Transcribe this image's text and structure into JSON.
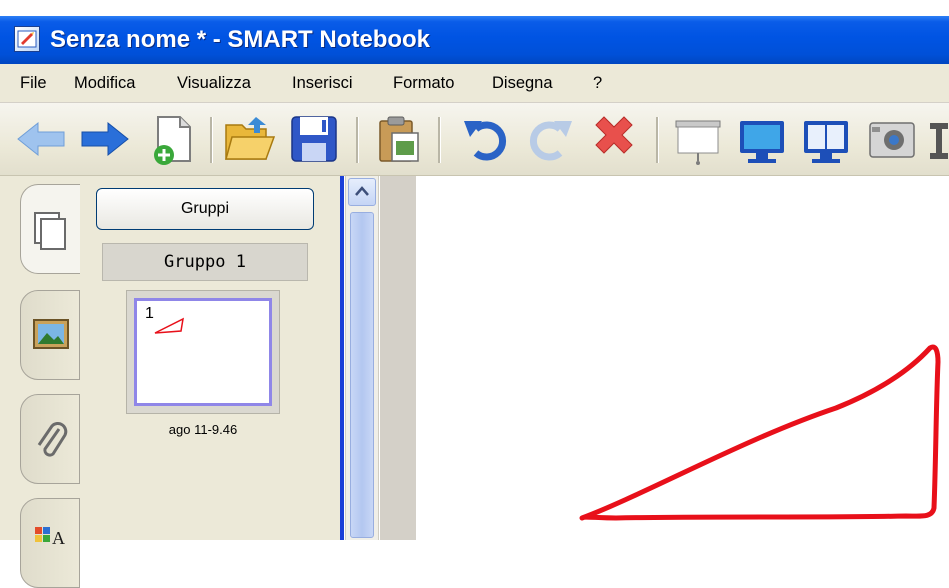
{
  "window": {
    "title": "Senza nome * - SMART Notebook",
    "app_icon": "smart-notebook-icon"
  },
  "menu": {
    "items": [
      "File",
      "Modifica",
      "Visualizza",
      "Inserisci",
      "Formato",
      "Disegna",
      "?"
    ]
  },
  "toolbar": {
    "icons": [
      "back-arrow-icon",
      "forward-arrow-icon",
      "new-page-icon",
      "open-folder-icon",
      "save-icon",
      "paste-icon",
      "undo-icon",
      "redo-icon",
      "delete-icon",
      "projector-screen-icon",
      "full-screen-icon",
      "dual-page-icon",
      "screen-capture-icon",
      "text-tool-icon"
    ]
  },
  "sidebar": {
    "tabs": [
      "page-sorter-tab-icon",
      "gallery-tab-icon",
      "attachments-tab-icon",
      "properties-tab-icon"
    ],
    "groups_button": "Gruppi",
    "group_label": "Gruppo 1",
    "page_thumbnail": {
      "number": "1",
      "timestamp": "ago 11-9.46"
    }
  },
  "colors": {
    "titlebar": "#0054e3",
    "drawing_stroke": "#e8101a",
    "thumbnail_border": "#8f86e8"
  }
}
